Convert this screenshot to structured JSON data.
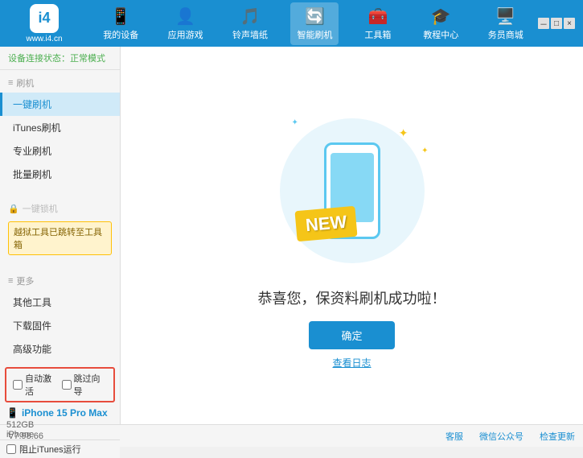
{
  "header": {
    "logo": {
      "icon": "i4",
      "url": "www.i4.cn"
    },
    "nav": [
      {
        "id": "my-device",
        "label": "我的设备",
        "icon": "📱"
      },
      {
        "id": "apps",
        "label": "应用游戏",
        "icon": "👤"
      },
      {
        "id": "ringtones",
        "label": "铃声墙纸",
        "icon": "🎵"
      },
      {
        "id": "smart-flash",
        "label": "智能刷机",
        "icon": "🔄",
        "active": true
      },
      {
        "id": "toolbox",
        "label": "工具箱",
        "icon": "🧰"
      },
      {
        "id": "tutorials",
        "label": "教程中心",
        "icon": "🎓"
      },
      {
        "id": "store",
        "label": "务员商城",
        "icon": "🖥️"
      }
    ]
  },
  "sidebar": {
    "status_label": "设备连接状态：",
    "status_value": "正常模式",
    "groups": [
      {
        "title": "刷机",
        "items": [
          {
            "label": "一键刷机",
            "active": true
          },
          {
            "label": "iTunes刷机"
          },
          {
            "label": "专业刷机"
          },
          {
            "label": "批量刷机"
          }
        ]
      },
      {
        "title": "一键锁机",
        "disabled": true,
        "warning": "越狱工具已跳转至工具箱"
      },
      {
        "title": "更多",
        "items": [
          {
            "label": "其他工具"
          },
          {
            "label": "下载固件"
          },
          {
            "label": "高级功能"
          }
        ]
      }
    ],
    "auto_activate_label": "自动激活",
    "time_guide_label": "跳过向导",
    "device_name": "iPhone 15 Pro Max",
    "device_storage": "512GB",
    "device_type": "iPhone",
    "itunes_label": "阻止iTunes运行"
  },
  "content": {
    "new_badge": "NEW",
    "success_message": "恭喜您，保资料刷机成功啦！",
    "confirm_button": "确定",
    "log_link": "查看日志"
  },
  "footer": {
    "version": "V7.98.66",
    "links": [
      "客服",
      "微信公众号",
      "检查更新"
    ]
  }
}
